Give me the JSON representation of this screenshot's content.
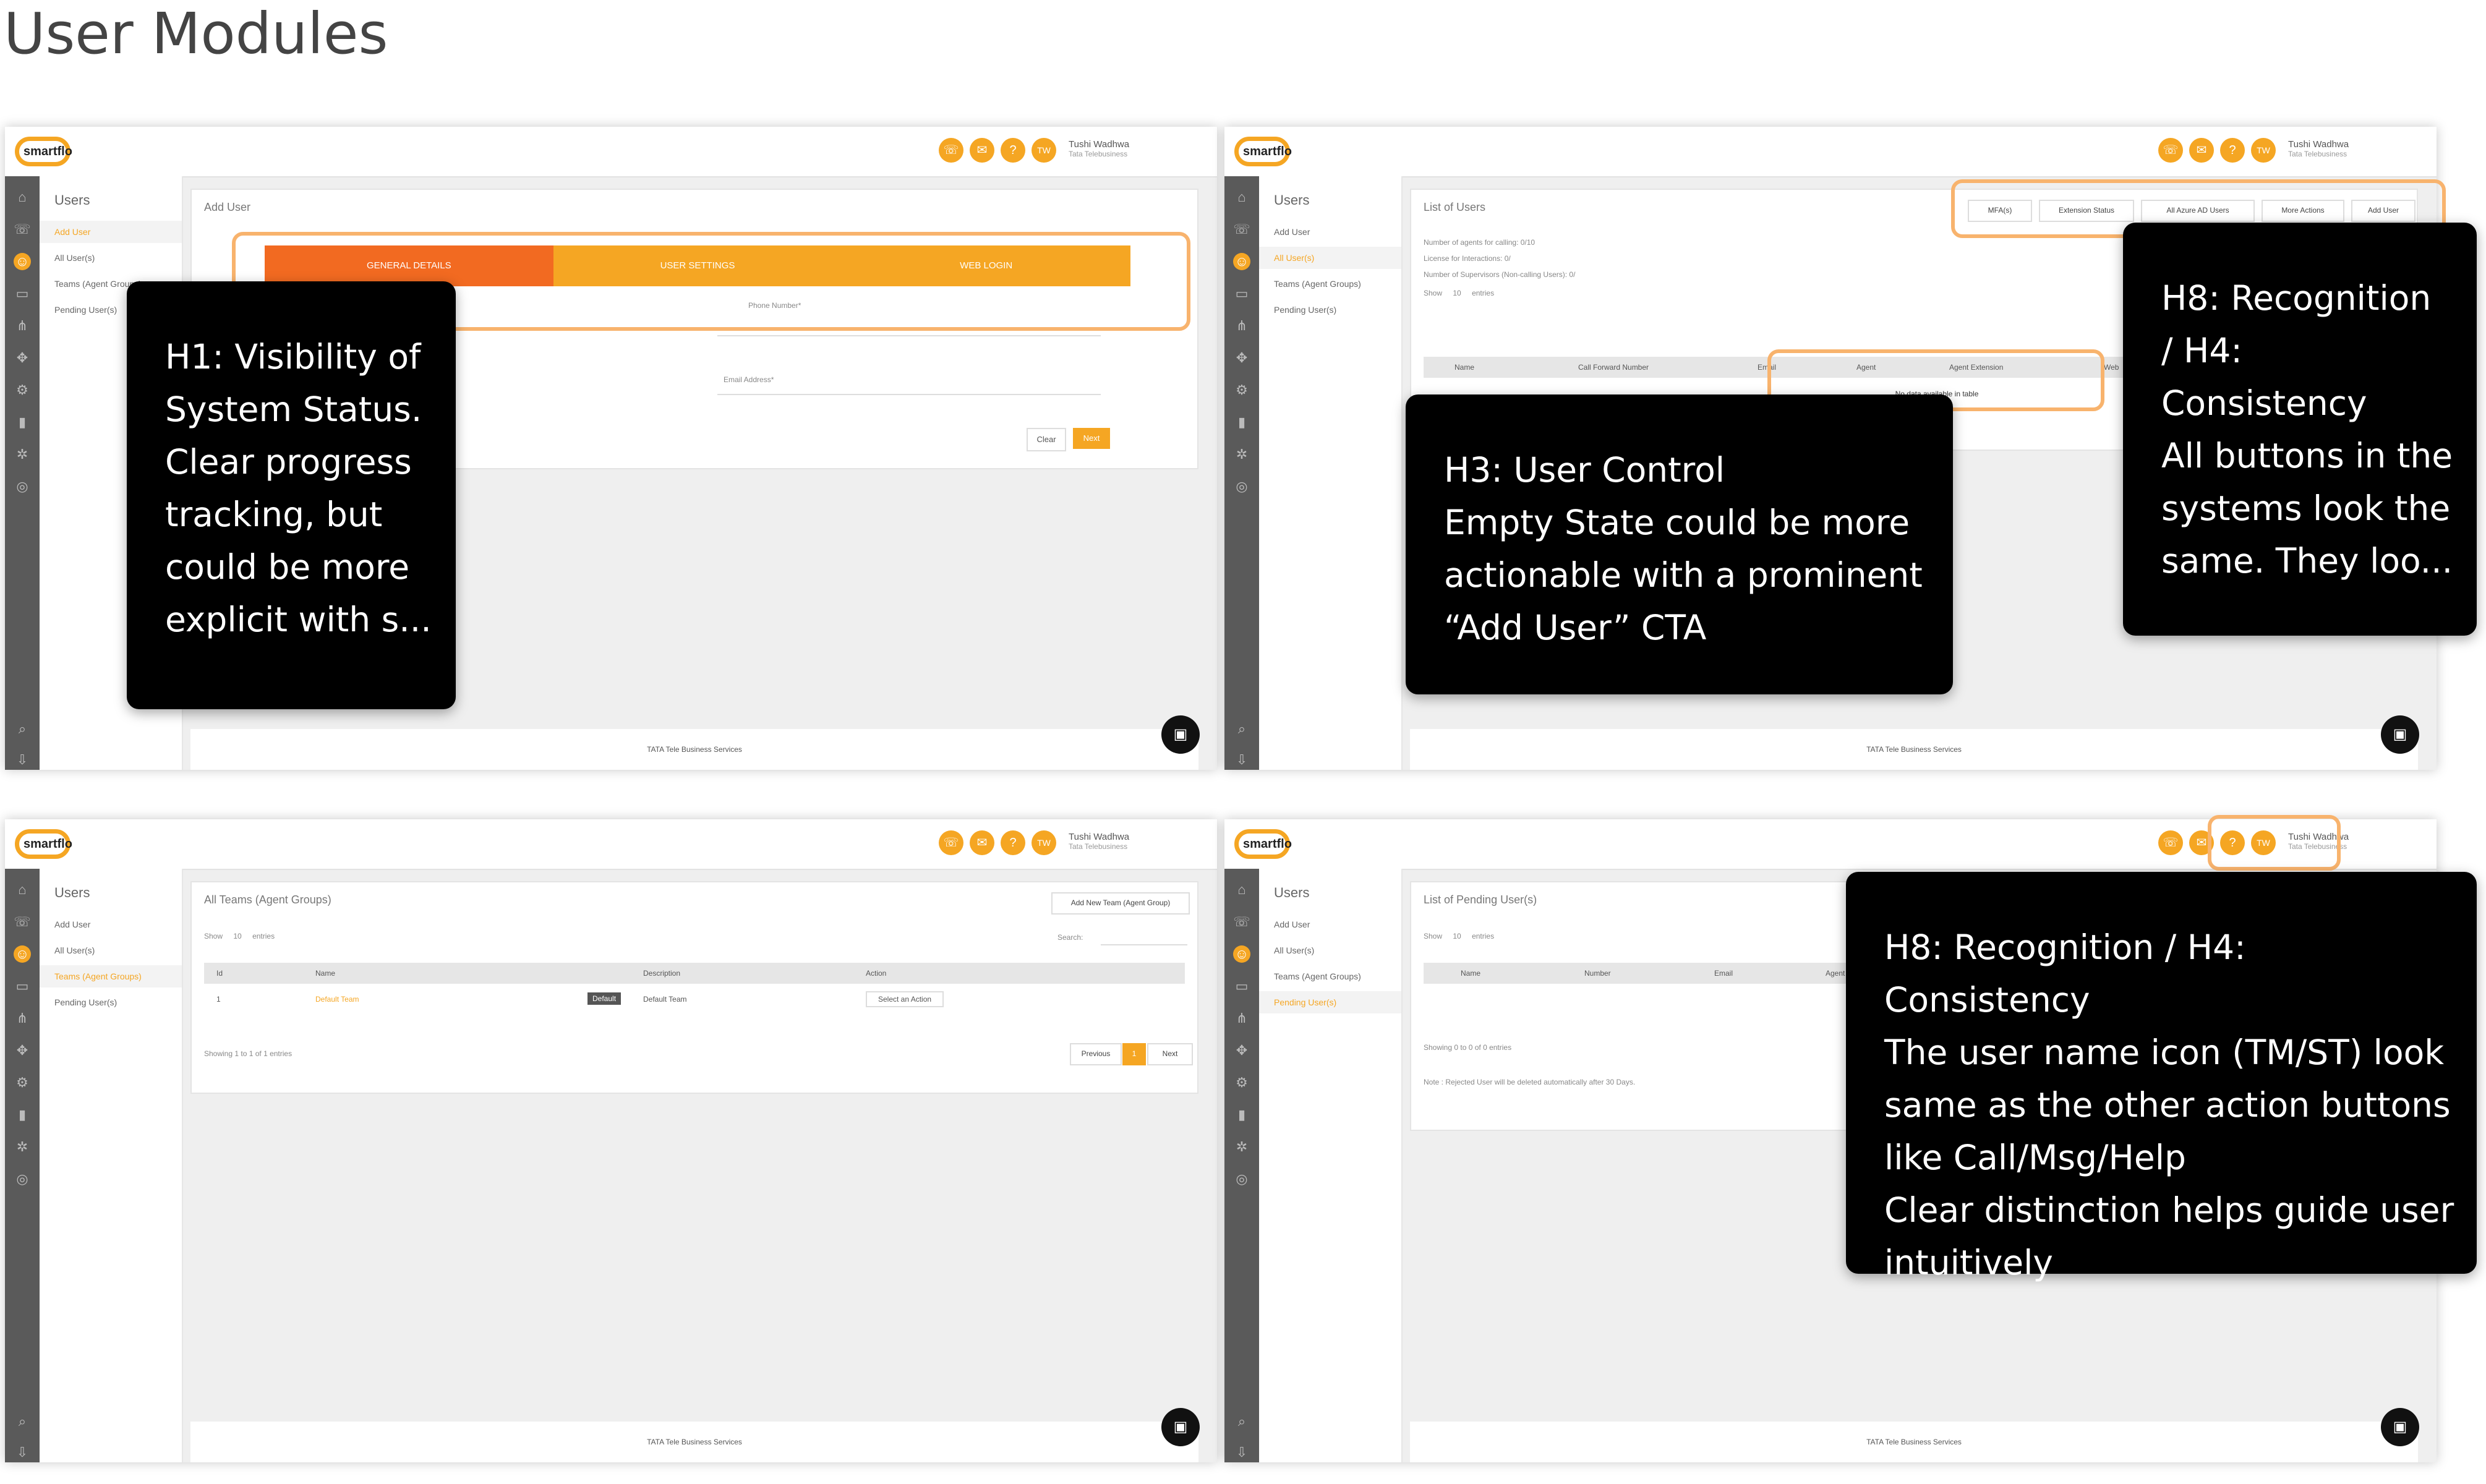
{
  "page_title": "User Modules",
  "app": {
    "logo_text": "smartflo",
    "user_name": "Tushi Wadhwa",
    "user_sub": "Tata Telebusiness",
    "footer": "TATA Tele Business Services",
    "topbar_icons": [
      "phone-icon",
      "message-icon",
      "help-icon"
    ],
    "avatar_initials": "TW",
    "accent": "#f5a623",
    "accent_active": "#f26a21"
  },
  "sidebar": {
    "heading": "Users",
    "items": [
      "Add User",
      "All User(s)",
      "Teams (Agent Groups)",
      "Pending User(s)"
    ]
  },
  "panel1": {
    "card_title": "Add User",
    "steps": [
      "GENERAL DETAILS",
      "USER SETTINGS",
      "WEB LOGIN"
    ],
    "fields": [
      "Phone Number*",
      "Email Address*"
    ],
    "clear_label": "Clear",
    "next_label": "Next"
  },
  "panel2": {
    "card_title": "List of Users",
    "stats": [
      "Number of agents for calling: 0/10",
      "License for Interactions: 0/",
      "Number of Supervisors (Non-calling Users): 0/"
    ],
    "show_label": "Show",
    "show_value": "10",
    "entries_label": "entries",
    "buttons": [
      "MFA(s)",
      "Extension Status",
      "All Azure AD Users",
      "More Actions",
      "Add User"
    ],
    "columns": [
      "Name",
      "Call Forward Number",
      "Email",
      "Agent",
      "Agent Extension",
      "Web"
    ],
    "empty_text": "No data available in table"
  },
  "panel3": {
    "card_title": "All Teams (Agent Groups)",
    "add_button": "Add New Team (Agent Group)",
    "show_label": "Show",
    "show_value": "10",
    "entries_label": "entries",
    "search_label": "Search:",
    "columns": [
      "Id",
      "Name",
      "Description",
      "Action"
    ],
    "row": {
      "id": "1",
      "name": "Default Team",
      "badge": "Default",
      "description": "Default Team",
      "action": "Select an Action"
    },
    "summary": "Showing 1 to 1 of 1 entries",
    "pager": [
      "Previous",
      "1",
      "Next"
    ]
  },
  "panel4": {
    "card_title": "List of Pending User(s)",
    "show_label": "Show",
    "show_value": "10",
    "entries_label": "entries",
    "columns": [
      "Name",
      "Number",
      "Email",
      "Agent"
    ],
    "summary": "Showing 0 to 0 of 0 entries",
    "note": "Note : Rejected User will be deleted automatically after 30 Days."
  },
  "annotations": {
    "h1": "H1: Visibility of\nSystem Status.\nClear progress\ntracking, but\ncould be more\nexplicit with s...",
    "h3": "H3: User Control\nEmpty State could be more\nactionable with a prominent\n“Add User” CTA",
    "h8a": "H8: Recognition\n/ H4:\nConsistency\nAll buttons in the\nsystems look the\nsame. They loo...",
    "h8b": "H8: Recognition / H4: Consistency\nThe user name icon (TM/ST) look\nsame as the other action buttons\nlike Call/Msg/Help\nClear distinction helps guide user\nintuitively"
  }
}
